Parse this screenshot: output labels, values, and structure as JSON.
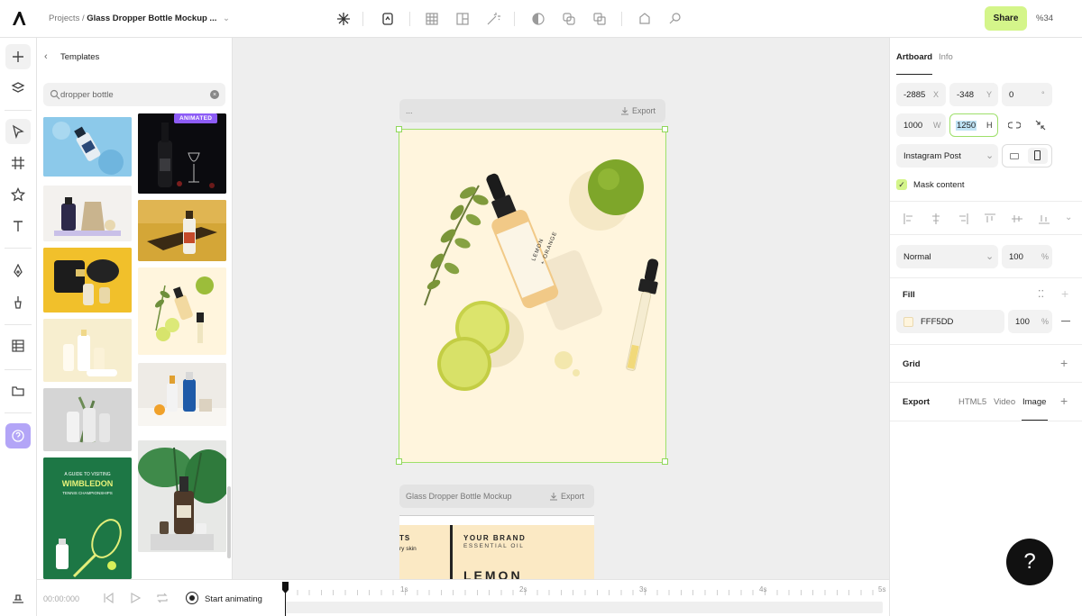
{
  "topbar": {
    "breadcrumb_root": "Projects /",
    "project_name": "Glass Dropper Bottle Mockup ...",
    "share_label": "Share",
    "zoom_label": "%34"
  },
  "templates_panel": {
    "title": "Templates",
    "search_value": "dropper bottle",
    "badge": "ANIMATED",
    "wimbledon_line1": "A GUIDE TO VISITING",
    "wimbledon_line2": "WIMBLEDON",
    "wimbledon_line3": "TENNIS CHAMPIONSHIPS"
  },
  "canvas": {
    "artboard1_name": "...",
    "export_label": "Export",
    "artboard2_name": "Glass Dropper Bottle Mockup",
    "bottle_label_line1": "LEMON",
    "bottle_label_line2": "+ ORANGE",
    "art2_brand": "YOUR BRAND",
    "art2_sub": "ESSENTIAL OIL",
    "art2_big": "LEMON",
    "art2_left1": "TS",
    "art2_left2": "ry skin"
  },
  "right_panel": {
    "tab_artboard": "Artboard",
    "tab_info": "Info",
    "x_value": "-2885",
    "x_unit": "X",
    "y_value": "-348",
    "y_unit": "Y",
    "rotation_value": "0",
    "rotation_unit": "°",
    "w_value": "1000",
    "w_unit": "W",
    "h_value": "1250",
    "h_unit": "H",
    "preset": "Instagram Post",
    "mask_label": "Mask content",
    "blend_mode": "Normal",
    "opacity": "100",
    "percent": "%",
    "fill_label": "Fill",
    "fill_hex": "FFF5DD",
    "fill_opacity": "100",
    "grid_label": "Grid",
    "export_label": "Export",
    "export_html5": "HTML5",
    "export_video": "Video",
    "export_image": "Image"
  },
  "timeline": {
    "time": "00:00:000",
    "start_label": "Start animating",
    "ticks": [
      "1s",
      "2s",
      "3s",
      "4s",
      "5s"
    ]
  },
  "colors": {
    "accent_green": "#d4f58a",
    "artboard_fill": "#fff5dd",
    "selection": "#9ee06a",
    "badge_purple": "#8d5cf6"
  }
}
